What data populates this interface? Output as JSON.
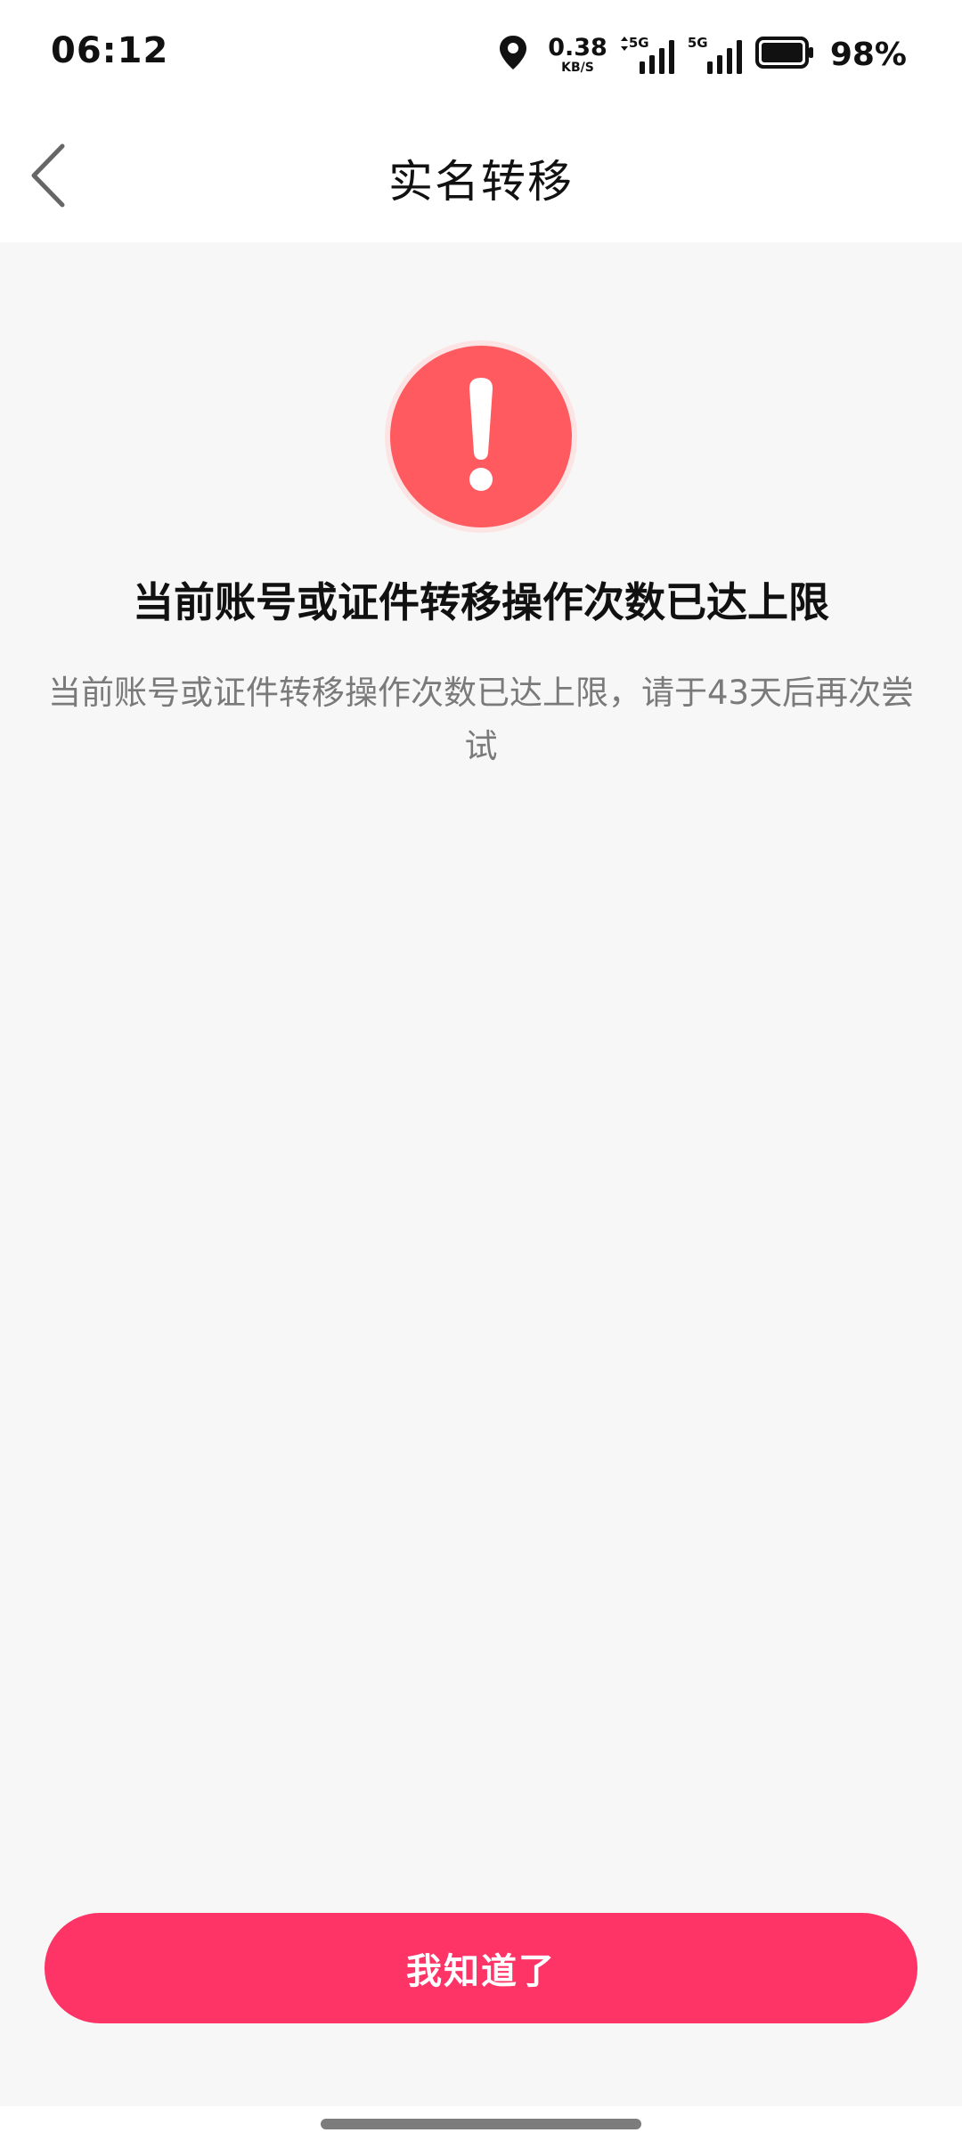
{
  "status_bar": {
    "time": "06:12",
    "location_icon": "location-pin-icon",
    "net_speed_value": "0.38",
    "net_speed_unit": "KB/S",
    "sim1_label": "5G",
    "sim2_label": "5G",
    "battery_percent": "98%"
  },
  "nav": {
    "back_icon": "chevron-left-icon",
    "title": "实名转移"
  },
  "alert": {
    "icon": "exclamation-circle-icon",
    "icon_color": "#ff5a5f",
    "headline": "当前账号或证件转移操作次数已达上限",
    "description": "当前账号或证件转移操作次数已达上限，请于43天后再次尝试"
  },
  "actions": {
    "confirm_label": "我知道了",
    "confirm_color": "#fe3466"
  }
}
